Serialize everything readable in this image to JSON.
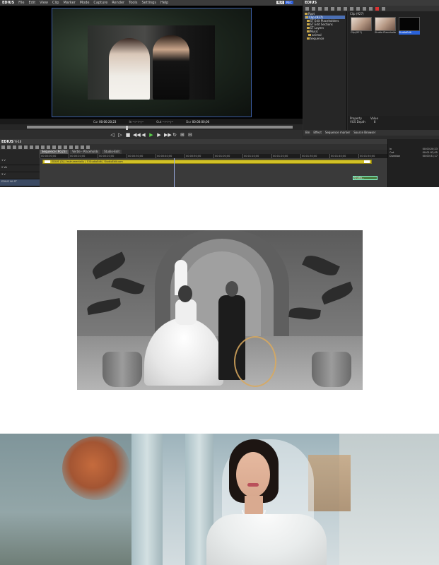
{
  "player": {
    "app_name": "EDIUS",
    "menu": [
      "File",
      "Edit",
      "View",
      "Clip",
      "Marker",
      "Mode",
      "Capture",
      "Render",
      "Tools",
      "Settings",
      "Help"
    ],
    "mode_badge_plr": "PLR",
    "mode_badge_rec": "REC",
    "timecodes": {
      "cur_label": "Cur",
      "cur_value": "00:00:20;23",
      "in_label": "In",
      "in_value": "--:--:--;--",
      "out_label": "Out",
      "out_value": "--:--:--;--",
      "dur_label": "Dur",
      "dur_value": "00:00:00;00"
    },
    "transport_icons": [
      "mark-in-icon",
      "mark-out-icon",
      "stop-icon",
      "rewind-icon",
      "step-back-icon",
      "play-icon",
      "step-forward-icon",
      "fast-forward-icon",
      "loop-icon",
      "insert-icon",
      "overwrite-icon"
    ]
  },
  "bin": {
    "title": "EDIUS",
    "tree": [
      {
        "label": "Root",
        "selected": false
      },
      {
        "label": "Clip (927)",
        "selected": true
      },
      {
        "label": "ST Edit Placeholders",
        "selected": false
      },
      {
        "label": "ST Edit Sections",
        "selected": false
      },
      {
        "label": "ST Layers",
        "selected": false
      },
      {
        "label": "Music",
        "selected": false
      },
      {
        "label": "animal",
        "selected": false
      },
      {
        "label": "Sequence",
        "selected": false
      }
    ],
    "path": "Clip (927)",
    "clips": [
      {
        "caption": "Clip(927)",
        "thumb": "warm",
        "selected": false
      },
      {
        "caption": "Studio Placeholders",
        "thumb": "warm",
        "selected": false
      },
      {
        "caption": "StudioEdit",
        "thumb": "dark",
        "selected": true
      }
    ],
    "properties_header": [
      "Property",
      "Value"
    ],
    "properties": [
      {
        "name": "VGS Depth",
        "value": "8"
      }
    ],
    "tabs": [
      "Bin",
      "Effect",
      "Sequence marker",
      "Source Browser"
    ]
  },
  "timeline": {
    "app_name": "EDIUS",
    "project_label": "Yi-10",
    "sequence_tabs": [
      {
        "label": "Sequence (RG23)",
        "active": true
      },
      {
        "label": "Vertle - Placeholds",
        "active": false
      },
      {
        "label": "Studio-Edit",
        "active": false
      }
    ],
    "tracks": [
      "1 V",
      "2 VA",
      "3 V",
      "1 V",
      "EDIUS VA ST"
    ],
    "ruler": [
      "00:00:00;00",
      "00:00:10;00",
      "00:00:20;00",
      "00:00:30;00",
      "00:00:40;00",
      "00:00:50;00",
      "00:01:00;00",
      "00:01:10;00",
      "00:01:20;00",
      "00:01:30;00",
      "00:01:40;00",
      "00:01:50;00"
    ],
    "clip_bar_label": "EDIUS (D) | Instrumentally | ©StudioEdit | StudioEdit.com",
    "studio_clip_label": "Studio...",
    "info_rows": [
      {
        "label": "In",
        "value": "00:00:20;23"
      },
      {
        "label": "Out",
        "value": "00:01:52;05"
      },
      {
        "label": "Duration",
        "value": "00:00:31;17"
      }
    ]
  }
}
